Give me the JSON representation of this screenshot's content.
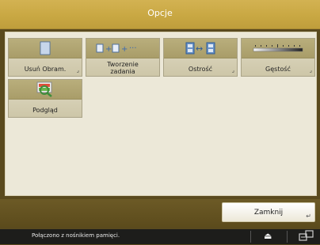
{
  "header": {
    "title": "Opcje"
  },
  "tiles": [
    {
      "label": "Usuń Obram.",
      "icon": "page-icon"
    },
    {
      "label": "Tworzenie zadania",
      "icon": "job-build-icon"
    },
    {
      "label": "Ostrość",
      "icon": "sharpness-icon"
    },
    {
      "label": "Gęstość",
      "icon": "density-icon"
    },
    {
      "label": "Podgląd",
      "icon": "preview-icon"
    }
  ],
  "footer": {
    "close_label": "Zamknij"
  },
  "status": {
    "message": "Połączono z nośnikiem pamięci."
  },
  "colors": {
    "titlebar": "#c9a843",
    "bottombar": "#5c4b1c",
    "content": "#ece8d8",
    "statusbar": "#1d1d1b"
  }
}
